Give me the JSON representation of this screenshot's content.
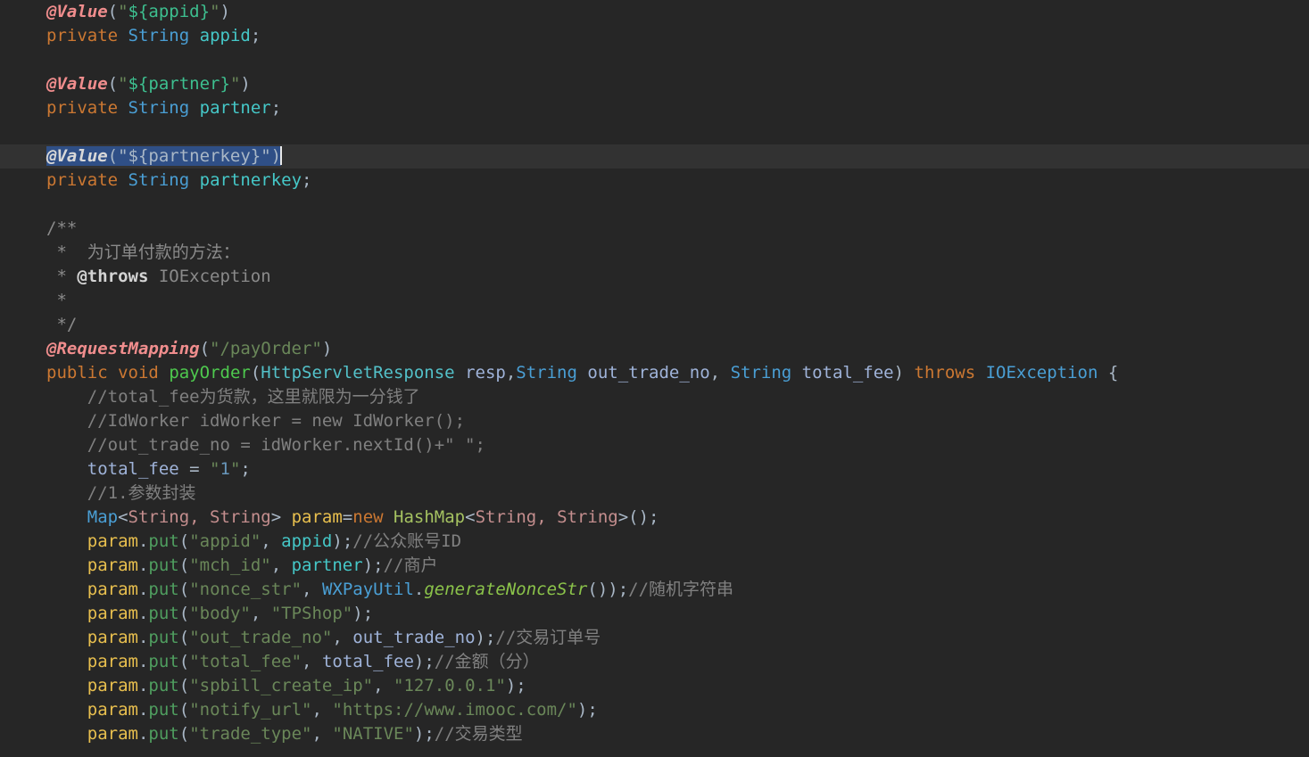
{
  "editor": {
    "theme": "darcula",
    "language": "Java",
    "background_color": "#262626",
    "current_line_color": "#323232",
    "selection_color": "#2f4f86",
    "caret_color": "#e8e8e8",
    "font_size_px": 19,
    "line_height_px": 27,
    "current_line_number": 7,
    "selection_text": "@Value(\"${partnerkey}\")"
  },
  "palette": {
    "keyword": "#cc7832",
    "annotation": "#f08d8d",
    "class": "#4a9fd5",
    "string": "#6a8759",
    "string_template": "#3dbf8f",
    "comment": "#808080",
    "javadoc": "#8a8a8a",
    "method_decl": "#4ec94e",
    "static_method": "#8bc34a",
    "local_var": "#e8bf4e",
    "field": "#45c8c8",
    "number": "#6897bb",
    "generic": "#c48e8e",
    "default_text": "#a9b7c6"
  },
  "lines": [
    {
      "id": 1,
      "indent": 0,
      "tokens": [
        {
          "t": "@Value",
          "c": "anno"
        },
        {
          "t": "(",
          "c": "punc"
        },
        {
          "t": "\"",
          "c": "str"
        },
        {
          "t": "${appid}",
          "c": "strbr"
        },
        {
          "t": "\"",
          "c": "str"
        },
        {
          "t": ")",
          "c": "punc"
        }
      ]
    },
    {
      "id": 2,
      "indent": 0,
      "tokens": [
        {
          "t": "private",
          "c": "kw"
        },
        {
          "t": " ",
          "c": "plain"
        },
        {
          "t": "String",
          "c": "cls"
        },
        {
          "t": " ",
          "c": "plain"
        },
        {
          "t": "appid",
          "c": "field"
        },
        {
          "t": ";",
          "c": "punc"
        }
      ]
    },
    {
      "id": 3,
      "indent": 0,
      "tokens": []
    },
    {
      "id": 4,
      "indent": 0,
      "tokens": [
        {
          "t": "@Value",
          "c": "anno"
        },
        {
          "t": "(",
          "c": "punc"
        },
        {
          "t": "\"",
          "c": "str"
        },
        {
          "t": "${partner}",
          "c": "strbr"
        },
        {
          "t": "\"",
          "c": "str"
        },
        {
          "t": ")",
          "c": "punc"
        }
      ]
    },
    {
      "id": 5,
      "indent": 0,
      "tokens": [
        {
          "t": "private",
          "c": "kw"
        },
        {
          "t": " ",
          "c": "plain"
        },
        {
          "t": "String",
          "c": "cls"
        },
        {
          "t": " ",
          "c": "plain"
        },
        {
          "t": "partner",
          "c": "field"
        },
        {
          "t": ";",
          "c": "punc"
        }
      ]
    },
    {
      "id": 6,
      "indent": 0,
      "tokens": []
    },
    {
      "id": 7,
      "indent": 0,
      "current": true,
      "selected": true,
      "caret_after": true,
      "tokens": [
        {
          "t": "@Value",
          "c": "anno"
        },
        {
          "t": "(\"${partnerkey}\")",
          "c": "punc"
        }
      ]
    },
    {
      "id": 8,
      "indent": 0,
      "tokens": [
        {
          "t": "private",
          "c": "kw"
        },
        {
          "t": " ",
          "c": "plain"
        },
        {
          "t": "String",
          "c": "cls"
        },
        {
          "t": " ",
          "c": "plain"
        },
        {
          "t": "partnerkey",
          "c": "field"
        },
        {
          "t": ";",
          "c": "punc"
        }
      ]
    },
    {
      "id": 9,
      "indent": 0,
      "tokens": []
    },
    {
      "id": 10,
      "indent": 0,
      "tokens": [
        {
          "t": "/**",
          "c": "doc"
        }
      ]
    },
    {
      "id": 11,
      "indent": 0,
      "tokens": [
        {
          "t": " *  为订单付款的方法：",
          "c": "doc"
        }
      ]
    },
    {
      "id": 12,
      "indent": 0,
      "tokens": [
        {
          "t": " * ",
          "c": "doc"
        },
        {
          "t": "@throws",
          "c": "doctag"
        },
        {
          "t": " IOException",
          "c": "doc"
        }
      ]
    },
    {
      "id": 13,
      "indent": 0,
      "tokens": [
        {
          "t": " *",
          "c": "doc"
        }
      ]
    },
    {
      "id": 14,
      "indent": 0,
      "tokens": [
        {
          "t": " */",
          "c": "doc"
        }
      ]
    },
    {
      "id": 15,
      "indent": 0,
      "tokens": [
        {
          "t": "@RequestMapping",
          "c": "anno"
        },
        {
          "t": "(",
          "c": "punc"
        },
        {
          "t": "\"/payOrder\"",
          "c": "str"
        },
        {
          "t": ")",
          "c": "punc"
        }
      ]
    },
    {
      "id": 16,
      "indent": 0,
      "tokens": [
        {
          "t": "public",
          "c": "kw"
        },
        {
          "t": " ",
          "c": "plain"
        },
        {
          "t": "void",
          "c": "kw"
        },
        {
          "t": " ",
          "c": "plain"
        },
        {
          "t": "payOrder",
          "c": "method"
        },
        {
          "t": "(",
          "c": "punc"
        },
        {
          "t": "HttpServletResponse",
          "c": "cls2"
        },
        {
          "t": " ",
          "c": "plain"
        },
        {
          "t": "resp",
          "c": "paramblue"
        },
        {
          "t": ",",
          "c": "punc"
        },
        {
          "t": "String",
          "c": "cls"
        },
        {
          "t": " ",
          "c": "plain"
        },
        {
          "t": "out_trade_no",
          "c": "paramblue"
        },
        {
          "t": ", ",
          "c": "punc"
        },
        {
          "t": "String",
          "c": "cls"
        },
        {
          "t": " ",
          "c": "plain"
        },
        {
          "t": "total_fee",
          "c": "paramblue"
        },
        {
          "t": ")",
          "c": "punc"
        },
        {
          "t": " ",
          "c": "plain"
        },
        {
          "t": "throws",
          "c": "kw"
        },
        {
          "t": " ",
          "c": "plain"
        },
        {
          "t": "IOException",
          "c": "cls"
        },
        {
          "t": " {",
          "c": "punc"
        }
      ]
    },
    {
      "id": 17,
      "indent": 1,
      "tokens": [
        {
          "t": "//total_fee为货款，这里就限为一分钱了",
          "c": "cmt"
        }
      ]
    },
    {
      "id": 18,
      "indent": 1,
      "tokens": [
        {
          "t": "//IdWorker idWorker = new IdWorker();",
          "c": "cmt"
        }
      ]
    },
    {
      "id": 19,
      "indent": 1,
      "tokens": [
        {
          "t": "//out_trade_no = idWorker.nextId()+\" \";",
          "c": "cmt"
        }
      ]
    },
    {
      "id": 20,
      "indent": 1,
      "tokens": [
        {
          "t": "total_fee",
          "c": "paramblue"
        },
        {
          "t": " = ",
          "c": "punc"
        },
        {
          "t": "\"",
          "c": "str"
        },
        {
          "t": "1",
          "c": "num"
        },
        {
          "t": "\"",
          "c": "str"
        },
        {
          "t": ";",
          "c": "punc"
        }
      ]
    },
    {
      "id": 21,
      "indent": 1,
      "tokens": [
        {
          "t": "//1.参数封装",
          "c": "cmt"
        }
      ]
    },
    {
      "id": 22,
      "indent": 1,
      "tokens": [
        {
          "t": "Map",
          "c": "cls"
        },
        {
          "t": "<",
          "c": "punc"
        },
        {
          "t": "String, String",
          "c": "gen"
        },
        {
          "t": "> ",
          "c": "punc"
        },
        {
          "t": "param",
          "c": "var"
        },
        {
          "t": "=",
          "c": "punc"
        },
        {
          "t": "new",
          "c": "kw"
        },
        {
          "t": " ",
          "c": "plain"
        },
        {
          "t": "HashMap",
          "c": "hash"
        },
        {
          "t": "<",
          "c": "punc"
        },
        {
          "t": "String, String",
          "c": "gen"
        },
        {
          "t": ">();",
          "c": "punc"
        }
      ]
    },
    {
      "id": 23,
      "indent": 1,
      "tokens": [
        {
          "t": "param",
          "c": "var"
        },
        {
          "t": ".",
          "c": "punc"
        },
        {
          "t": "put",
          "c": "mcall"
        },
        {
          "t": "(",
          "c": "punc"
        },
        {
          "t": "\"appid\"",
          "c": "str"
        },
        {
          "t": ", ",
          "c": "punc"
        },
        {
          "t": "appid",
          "c": "field"
        },
        {
          "t": ");",
          "c": "punc"
        },
        {
          "t": "//公众账号ID",
          "c": "cmt"
        }
      ]
    },
    {
      "id": 24,
      "indent": 1,
      "tokens": [
        {
          "t": "param",
          "c": "var"
        },
        {
          "t": ".",
          "c": "punc"
        },
        {
          "t": "put",
          "c": "mcall"
        },
        {
          "t": "(",
          "c": "punc"
        },
        {
          "t": "\"mch_id\"",
          "c": "str"
        },
        {
          "t": ", ",
          "c": "punc"
        },
        {
          "t": "partner",
          "c": "field"
        },
        {
          "t": ");",
          "c": "punc"
        },
        {
          "t": "//商户",
          "c": "cmt"
        }
      ]
    },
    {
      "id": 25,
      "indent": 1,
      "tokens": [
        {
          "t": "param",
          "c": "var"
        },
        {
          "t": ".",
          "c": "punc"
        },
        {
          "t": "put",
          "c": "mcall"
        },
        {
          "t": "(",
          "c": "punc"
        },
        {
          "t": "\"nonce_str\"",
          "c": "str"
        },
        {
          "t": ", ",
          "c": "punc"
        },
        {
          "t": "WXPayUtil",
          "c": "cls"
        },
        {
          "t": ".",
          "c": "punc"
        },
        {
          "t": "generateNonceStr",
          "c": "static"
        },
        {
          "t": "());",
          "c": "punc"
        },
        {
          "t": "//随机字符串",
          "c": "cmt"
        }
      ]
    },
    {
      "id": 26,
      "indent": 1,
      "tokens": [
        {
          "t": "param",
          "c": "var"
        },
        {
          "t": ".",
          "c": "punc"
        },
        {
          "t": "put",
          "c": "mcall"
        },
        {
          "t": "(",
          "c": "punc"
        },
        {
          "t": "\"body\"",
          "c": "str"
        },
        {
          "t": ", ",
          "c": "punc"
        },
        {
          "t": "\"TPShop\"",
          "c": "str"
        },
        {
          "t": ");",
          "c": "punc"
        }
      ]
    },
    {
      "id": 27,
      "indent": 1,
      "tokens": [
        {
          "t": "param",
          "c": "var"
        },
        {
          "t": ".",
          "c": "punc"
        },
        {
          "t": "put",
          "c": "mcall"
        },
        {
          "t": "(",
          "c": "punc"
        },
        {
          "t": "\"out_trade_no\"",
          "c": "str"
        },
        {
          "t": ", ",
          "c": "punc"
        },
        {
          "t": "out_trade_no",
          "c": "paramblue"
        },
        {
          "t": ");",
          "c": "punc"
        },
        {
          "t": "//交易订单号",
          "c": "cmt"
        }
      ]
    },
    {
      "id": 28,
      "indent": 1,
      "tokens": [
        {
          "t": "param",
          "c": "var"
        },
        {
          "t": ".",
          "c": "punc"
        },
        {
          "t": "put",
          "c": "mcall"
        },
        {
          "t": "(",
          "c": "punc"
        },
        {
          "t": "\"total_fee\"",
          "c": "str"
        },
        {
          "t": ", ",
          "c": "punc"
        },
        {
          "t": "total_fee",
          "c": "paramblue"
        },
        {
          "t": ");",
          "c": "punc"
        },
        {
          "t": "//金额（分）",
          "c": "cmt"
        }
      ]
    },
    {
      "id": 29,
      "indent": 1,
      "tokens": [
        {
          "t": "param",
          "c": "var"
        },
        {
          "t": ".",
          "c": "punc"
        },
        {
          "t": "put",
          "c": "mcall"
        },
        {
          "t": "(",
          "c": "punc"
        },
        {
          "t": "\"spbill_create_ip\"",
          "c": "str"
        },
        {
          "t": ", ",
          "c": "punc"
        },
        {
          "t": "\"127.0.0.1\"",
          "c": "str"
        },
        {
          "t": ");",
          "c": "punc"
        }
      ]
    },
    {
      "id": 30,
      "indent": 1,
      "tokens": [
        {
          "t": "param",
          "c": "var"
        },
        {
          "t": ".",
          "c": "punc"
        },
        {
          "t": "put",
          "c": "mcall"
        },
        {
          "t": "(",
          "c": "punc"
        },
        {
          "t": "\"notify_url\"",
          "c": "str"
        },
        {
          "t": ", ",
          "c": "punc"
        },
        {
          "t": "\"https://www.imooc.com/\"",
          "c": "str"
        },
        {
          "t": ");",
          "c": "punc"
        }
      ]
    },
    {
      "id": 31,
      "indent": 1,
      "tokens": [
        {
          "t": "param",
          "c": "var"
        },
        {
          "t": ".",
          "c": "punc"
        },
        {
          "t": "put",
          "c": "mcall"
        },
        {
          "t": "(",
          "c": "punc"
        },
        {
          "t": "\"trade_type\"",
          "c": "str"
        },
        {
          "t": ", ",
          "c": "punc"
        },
        {
          "t": "\"NATIVE\"",
          "c": "str"
        },
        {
          "t": ");",
          "c": "punc"
        },
        {
          "t": "//交易类型",
          "c": "cmt"
        }
      ]
    }
  ]
}
